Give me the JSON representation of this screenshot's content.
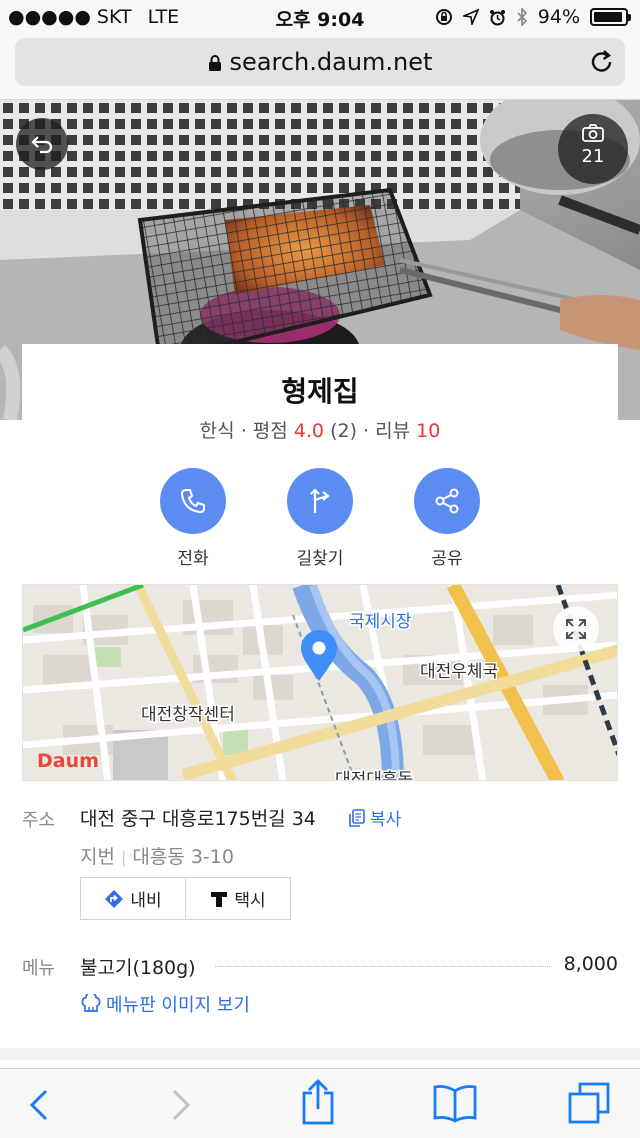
{
  "status": {
    "carrier": "●●●●● SKT",
    "network": "LTE",
    "time": "오후 9:04",
    "battery": "94%",
    "battery_level": 0.94
  },
  "browser": {
    "url": "search.daum.net"
  },
  "hero": {
    "photo_count": "21"
  },
  "place": {
    "name": "형제집",
    "category": "한식",
    "rating_label": "평점",
    "rating": "4.0",
    "rating_count": "(2)",
    "review_label": "리뷰",
    "review_count": "10",
    "sep": "·"
  },
  "actions": [
    {
      "label": "전화",
      "icon": "phone-icon"
    },
    {
      "label": "길찾기",
      "icon": "directions-icon"
    },
    {
      "label": "공유",
      "icon": "share-icon"
    }
  ],
  "map": {
    "labels": {
      "market": "국제시장",
      "post_office": "대전우체국",
      "center": "대전창작센터",
      "station": "대전대흥동"
    },
    "logo": "Daum",
    "accent": "#5b8cf2"
  },
  "address": {
    "label": "주소",
    "road": "대전 중구 대흥로175번길 34",
    "copy": "복사",
    "jibun_label": "지번",
    "jibun": "대흥동 3-10",
    "navi": "내비",
    "taxi": "택시"
  },
  "menu": {
    "label": "메뉴",
    "items": [
      {
        "name": "불고기(180g)",
        "price": "8,000"
      }
    ],
    "image_link": "메뉴판 이미지 보기"
  },
  "colors": {
    "link": "#2f6ee6",
    "rating": "#e5383b",
    "button": "#5b8cf2",
    "safari_blue": "#1a7cf5"
  }
}
